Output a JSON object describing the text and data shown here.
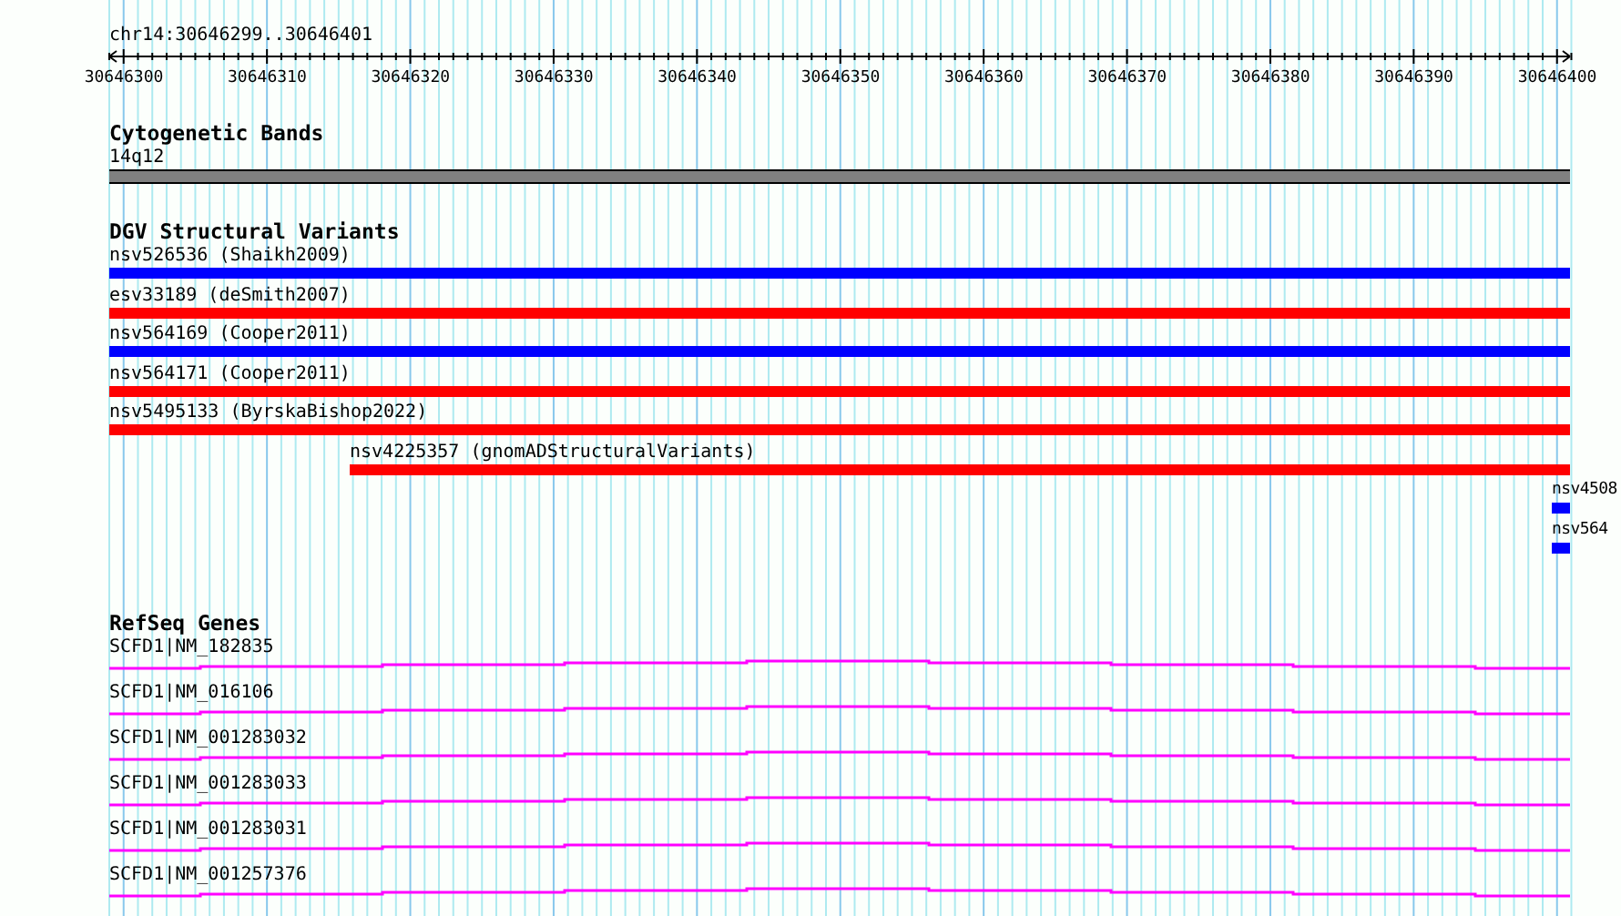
{
  "ruler": {
    "location": "chr14:30646299..30646401",
    "ticks": [
      "30646300",
      "30646310",
      "30646320",
      "30646330",
      "30646340",
      "30646350",
      "30646360",
      "30646370",
      "30646380",
      "30646390",
      "30646400"
    ]
  },
  "tracks": [
    {
      "kind": "bands",
      "title": "Cytogenetic Bands",
      "features": [
        {
          "label": "14q12",
          "kind": "full"
        }
      ]
    },
    {
      "kind": "variants",
      "title": "DGV Structural Variants",
      "features": [
        {
          "label": "nsv526536 (Shaikh2009)",
          "kind": "full",
          "color": "#0000ff"
        },
        {
          "label": "esv33189 (deSmith2007)",
          "kind": "full",
          "color": "#ff0000"
        },
        {
          "label": "nsv564169 (Cooper2011)",
          "kind": "full",
          "color": "#0000ff"
        },
        {
          "label": "nsv564171 (Cooper2011)",
          "kind": "full",
          "color": "#ff0000"
        },
        {
          "label": "nsv5495133 (ByrskaBishop2022)",
          "kind": "full",
          "color": "#ff0000"
        },
        {
          "label": "nsv4225357 (gnomADStructuralVariants)",
          "kind": "partial",
          "color": "#ff0000"
        },
        {
          "label": "nsv4508",
          "kind": "edge",
          "color": "#0000ff"
        },
        {
          "label": "nsv564",
          "kind": "edge",
          "color": "#0000ff"
        }
      ]
    },
    {
      "kind": "genes",
      "title": "RefSeq Genes",
      "features": [
        {
          "label": "SCFD1|NM_182835",
          "kind": "full"
        },
        {
          "label": "SCFD1|NM_016106",
          "kind": "full"
        },
        {
          "label": "SCFD1|NM_001283032",
          "kind": "full"
        },
        {
          "label": "SCFD1|NM_001283033",
          "kind": "full"
        },
        {
          "label": "SCFD1|NM_001283031",
          "kind": "full"
        },
        {
          "label": "SCFD1|NM_001257376",
          "kind": "full"
        }
      ]
    }
  ]
}
